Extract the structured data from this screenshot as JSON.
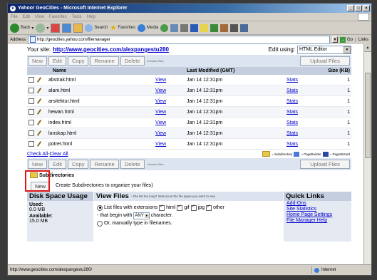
{
  "window": {
    "title": "Yahoo! GeoCities - Microsoft Internet Explorer"
  },
  "menu": [
    "File",
    "Edit",
    "View",
    "Favorites",
    "Tools",
    "Help"
  ],
  "toolbar": {
    "back": "Back",
    "search": "Search",
    "favorites": "Favorites",
    "media": "Media"
  },
  "address": {
    "label": "Address",
    "url": "http://geocities.yahoo.com/filemanager",
    "go": "Go",
    "links": "Links"
  },
  "site": {
    "label": "Your site:",
    "url": "http://www.geocities.com/alexpangestu280",
    "edit_using_label": "Edit using:",
    "editor": "HTML Editor"
  },
  "actions": {
    "new": "New",
    "edit": "Edit",
    "copy": "Copy",
    "rename": "Rename",
    "delete": "Delete",
    "checked_files": "checked files",
    "upload": "Upload Files"
  },
  "table": {
    "headers": {
      "name": "Name",
      "modified": "Last Modified (GMT)",
      "size": "Size (KB)"
    },
    "rows": [
      {
        "name": "abstrak.html",
        "view": "View",
        "modified": "Jan 14 12:31pm",
        "stats": "Stats",
        "size": "1"
      },
      {
        "name": "alam.html",
        "view": "View",
        "modified": "Jan 14 12:31pm",
        "stats": "Stats",
        "size": "1"
      },
      {
        "name": "arsitektur.html",
        "view": "View",
        "modified": "Jan 14 12:31pm",
        "stats": "Stats",
        "size": "1"
      },
      {
        "name": "hewan.html",
        "view": "View",
        "modified": "Jan 14 12:31pm",
        "stats": "Stats",
        "size": "1"
      },
      {
        "name": "index.html",
        "view": "View",
        "modified": "Jan 14 12:31pm",
        "stats": "Stats",
        "size": "1"
      },
      {
        "name": "lanskap.html",
        "view": "View",
        "modified": "Jan 14 12:31pm",
        "stats": "Stats",
        "size": "1"
      },
      {
        "name": "potret.html",
        "view": "View",
        "modified": "Jan 14 12:31pm",
        "stats": "Stats",
        "size": "1"
      }
    ]
  },
  "checkall": {
    "check_all": "Check All",
    "sep": " - ",
    "clear_all": "Clear All",
    "legend_subdir": "= Subdirectory",
    "legend_pagebuilder": "= PageBuilder",
    "legend_pagewizard": "= PageWizard"
  },
  "subdirectories": {
    "title": "Subdirectories",
    "new_button": "New",
    "desc": "Create Subdirectories to organize your files)"
  },
  "disk": {
    "title": "Disk Space Usage",
    "used_label": "Used:",
    "used_value": "0.0 MB",
    "available_label": "Available:",
    "available_value": "15.0 MB"
  },
  "view_files": {
    "title": "View Files",
    "hint": "- File list too long? Select just the file types you want to see.",
    "list_ext": "List files with extensions",
    "ext": [
      "html",
      "gif",
      "jpg",
      "other"
    ],
    "begin_prefix": "- that begin with",
    "begin_value": "ANY",
    "begin_suffix": "character.",
    "or_manual": "Or, manually type in filenames."
  },
  "quick_links": {
    "title": "Quick Links",
    "items": [
      "Add-Ons",
      "Site Statistics",
      "Home Page Settings",
      "File Manager Help"
    ]
  },
  "status": {
    "url": "http://www.geocities.com/alexpangestu280/",
    "zone": "Internet"
  },
  "colors": {
    "highlight": "#e01818",
    "link": "#0000cc",
    "header_bg": "#c4cede",
    "panel_bg": "#e4e9f2"
  }
}
